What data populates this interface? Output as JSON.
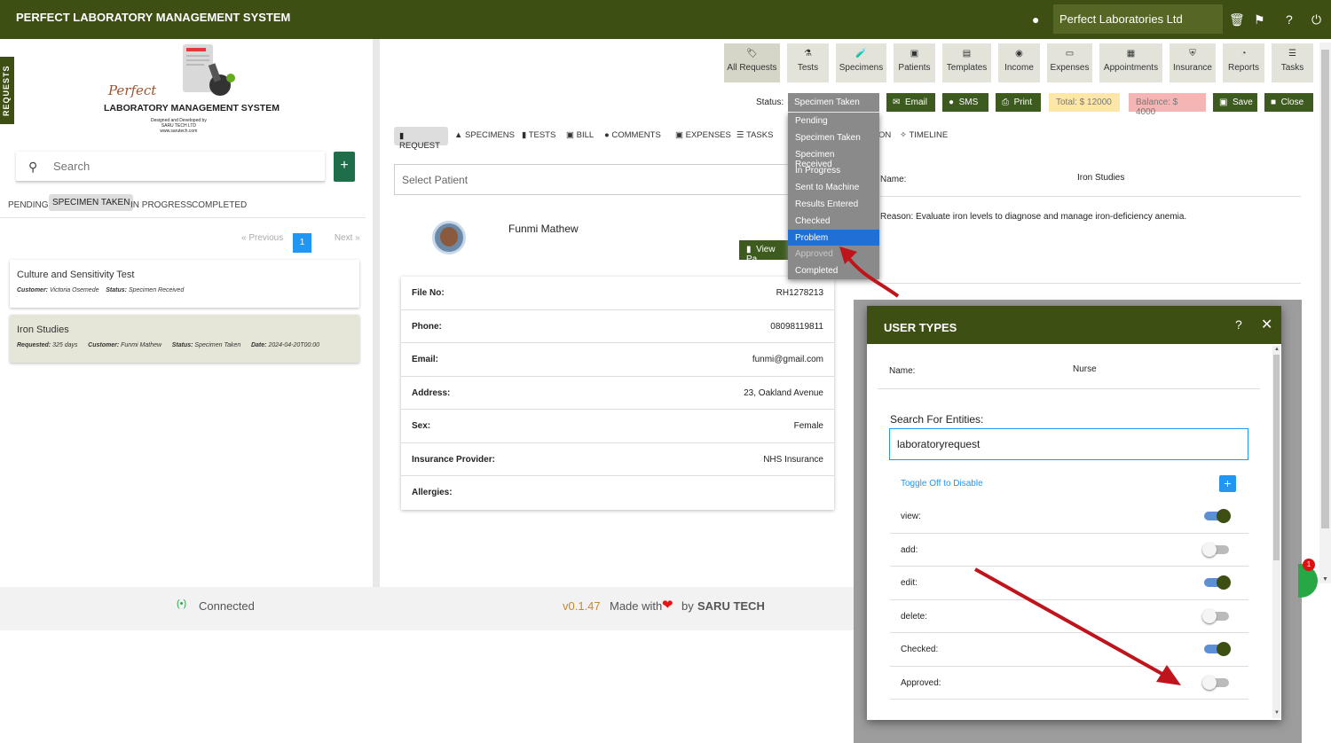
{
  "app": {
    "title": "PERFECT LABORATORY MANAGEMENT SYSTEM",
    "company": "Perfect Laboratories Ltd"
  },
  "sidebar_tab": "REQUESTS",
  "logo": {
    "line1": "Perfect",
    "line2": "LABORATORY MANAGEMENT SYSTEM",
    "small1": "Designed and Developed by",
    "small2": "SARU TECH LTD",
    "small3": "www.sarutech.com"
  },
  "left": {
    "search_placeholder": "Search",
    "add_label": "+",
    "tabs": [
      "PENDING",
      "SPECIMEN TAKEN",
      "IN PROGRESS",
      "COMPLETED"
    ],
    "pagination": {
      "prev": "« Previous",
      "page": "1",
      "next": "Next »"
    },
    "cards": [
      {
        "title": "Culture and Sensitivity Test",
        "customer_k": "Customer:",
        "customer": "Victoria Osemede",
        "status_k": "Status:",
        "status": "Specimen Received"
      },
      {
        "title": "Iron Studies",
        "requested_k": "Requested:",
        "requested": "325 days",
        "customer_k": "Customer:",
        "customer": "Funmi Mathew",
        "status_k": "Status:",
        "status": "Specimen Taken",
        "date_k": "Date:",
        "date": "2024-04-20T00:00"
      }
    ]
  },
  "nav": [
    {
      "label": "All Requests",
      "icon": "tag-icon",
      "glyph": "🏷"
    },
    {
      "label": "Tests",
      "icon": "flask-icon",
      "glyph": "⚗"
    },
    {
      "label": "Specimens",
      "icon": "specimen-icon",
      "glyph": "🧪"
    },
    {
      "label": "Patients",
      "icon": "id-card-icon",
      "glyph": "▣"
    },
    {
      "label": "Templates",
      "icon": "file-icon",
      "glyph": "▤"
    },
    {
      "label": "Income",
      "icon": "coins-icon",
      "glyph": "◉"
    },
    {
      "label": "Expenses",
      "icon": "money-icon",
      "glyph": "▭"
    },
    {
      "label": "Appointments",
      "icon": "calendar-icon",
      "glyph": "▦"
    },
    {
      "label": "Insurance",
      "icon": "shield-icon",
      "glyph": "⛨"
    },
    {
      "label": "Reports",
      "icon": "pie-chart-icon",
      "glyph": "◔"
    },
    {
      "label": "Tasks",
      "icon": "list-icon",
      "glyph": "☰"
    }
  ],
  "status_bar": {
    "label": "Status:",
    "value": "Specimen Taken",
    "email": "Email",
    "sms": "SMS",
    "print": "Print",
    "total": "Total: $ 12000",
    "balance": "Balance: $ 4000",
    "save": "Save",
    "close": "Close"
  },
  "status_options": [
    {
      "label": "Pending",
      "state": "normal"
    },
    {
      "label": "Specimen Taken",
      "state": "normal"
    },
    {
      "label": "Specimen Received",
      "state": "normal"
    },
    {
      "label": "In Progress",
      "state": "normal"
    },
    {
      "label": "Sent to Machine",
      "state": "normal"
    },
    {
      "label": "Results Entered",
      "state": "normal"
    },
    {
      "label": "Checked",
      "state": "normal"
    },
    {
      "label": "Problem",
      "state": "selected"
    },
    {
      "label": "Approved",
      "state": "disabled"
    },
    {
      "label": "Completed",
      "state": "normal"
    }
  ],
  "tabs": {
    "request": "REQUEST",
    "specimens": "SPECIMENS",
    "tests": "TESTS",
    "bill": "BILL",
    "comments": "COMMENTS",
    "expenses": "EXPENSES",
    "tasks": "TASKS",
    "on": "ON",
    "timeline": "TIMELINE"
  },
  "patient": {
    "select_placeholder": "Select  Patient",
    "name": "Funmi Mathew",
    "view_btn": "View Pa",
    "rows": [
      {
        "k": "File No:",
        "v": "RH1278213"
      },
      {
        "k": "Phone:",
        "v": "08098119811"
      },
      {
        "k": "Email:",
        "v": "funmi@gmail.com"
      },
      {
        "k": "Address:",
        "v": "23, Oakland Avenue"
      },
      {
        "k": "Sex:",
        "v": "Female"
      },
      {
        "k": "Insurance Provider:",
        "v": "NHS Insurance"
      },
      {
        "k": "Allergies:",
        "v": ""
      }
    ]
  },
  "test_info": {
    "name_k": "Name:",
    "name_v": "Iron Studies",
    "reason": "Reason:  Evaluate iron levels to diagnose and manage iron-deficiency anemia."
  },
  "badge_count": "1",
  "modal": {
    "title": "USER TYPES",
    "help": "?",
    "close": "✕",
    "name_k": "Name:",
    "name_v": "Nurse",
    "search_label": "Search For Entities:",
    "search_value": "laboratoryrequest",
    "toggle_label": "Toggle Off to Disable",
    "add": "+",
    "permissions": [
      {
        "label": "view:",
        "on": true
      },
      {
        "label": "add:",
        "on": false
      },
      {
        "label": "edit:",
        "on": true
      },
      {
        "label": "delete:",
        "on": false
      },
      {
        "label": "Checked:",
        "on": true
      },
      {
        "label": "Approved:",
        "on": false
      }
    ]
  },
  "footer": {
    "connected": "Connected",
    "version": "v0.1.47",
    "made_with": "Made with",
    "by": "by",
    "company": "SARU TECH"
  },
  "colors": {
    "brand": "#3d4f13",
    "accent": "#2196f3",
    "annotation_arrow": "#c0141c"
  }
}
